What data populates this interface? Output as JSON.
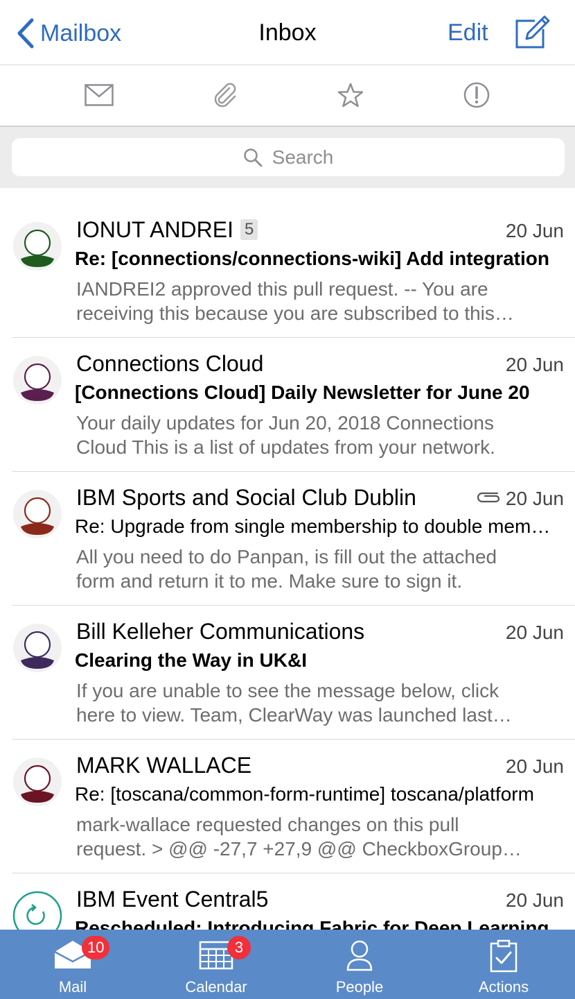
{
  "nav": {
    "back_label": "Mailbox",
    "title": "Inbox",
    "edit_label": "Edit"
  },
  "filters": [
    {
      "name": "envelope-icon"
    },
    {
      "name": "paperclip-icon"
    },
    {
      "name": "star-icon"
    },
    {
      "name": "exclamation-circle-icon"
    }
  ],
  "search": {
    "placeholder": "Search"
  },
  "messages": [
    {
      "sender": "IONUT ANDREI",
      "count": "5",
      "date": "20 Jun",
      "subject": "Re: [connections/connections-wiki] Add integration",
      "preview": "IANDREI2 approved this pull request. -- You are receiving this because you are subscribed to this thread.",
      "unread": true,
      "attachment": false,
      "avatar_color": "#1f5a1f"
    },
    {
      "sender": "Connections Cloud",
      "count": "",
      "date": "20 Jun",
      "subject": "[Connections Cloud] Daily Newsletter for June 20",
      "preview": "Your daily updates for Jun 20, 2018 Connections Cloud This is a list of updates from your network.",
      "unread": true,
      "attachment": false,
      "avatar_color": "#5b1f4f"
    },
    {
      "sender": "IBM Sports and Social Club Dublin",
      "count": "",
      "date": "20 Jun",
      "subject": "Re: Upgrade from single membership to double membership",
      "preview": "All you need to do Panpan, is fill out the attached form and return it to me. Make sure to sign it.",
      "unread": false,
      "attachment": true,
      "avatar_color": "#8a2a1a"
    },
    {
      "sender": "Bill Kelleher Communications",
      "count": "",
      "date": "20 Jun",
      "subject": "Clearing the Way in UK&I",
      "preview": "If you are unable to see the message below, click here to view. Team, ClearWay was launched last year.",
      "unread": true,
      "attachment": false,
      "avatar_color": "#3e2a5c"
    },
    {
      "sender": "MARK WALLACE",
      "count": "",
      "date": "20 Jun",
      "subject": "Re: [toscana/common-form-runtime] toscana/platform",
      "preview": "mark-wallace requested changes on this pull request. > @@ -27,7 +27,9 @@ CheckboxGroup extends",
      "unread": false,
      "attachment": false,
      "avatar_color": "#6a1424"
    },
    {
      "sender": "IBM Event Central5",
      "count": "",
      "date": "20 Jun",
      "subject": "Rescheduled: Introducing Fabric for Deep Learning",
      "preview": "",
      "unread": true,
      "attachment": false,
      "avatar_color": "#1aa08a"
    }
  ],
  "tabs": [
    {
      "label": "Mail",
      "badge": "10"
    },
    {
      "label": "Calendar",
      "badge": "3"
    },
    {
      "label": "People",
      "badge": ""
    },
    {
      "label": "Actions",
      "badge": ""
    }
  ],
  "colors": {
    "accent": "#2f6cc2",
    "tabbar": "#5b8ac8",
    "badge": "#f0303a"
  }
}
